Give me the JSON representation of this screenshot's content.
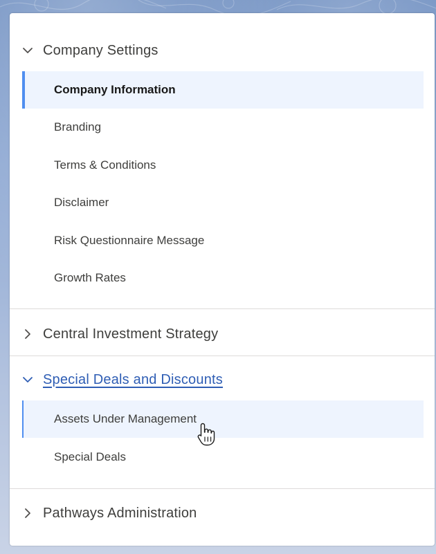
{
  "sections": [
    {
      "title": "Company Settings",
      "expanded": true,
      "items": [
        {
          "label": "Company Information",
          "state": "selected"
        },
        {
          "label": "Branding"
        },
        {
          "label": "Terms & Conditions"
        },
        {
          "label": "Disclaimer"
        },
        {
          "label": "Risk Questionnaire Message"
        },
        {
          "label": "Growth Rates"
        }
      ]
    },
    {
      "title": "Central Investment Strategy",
      "expanded": false,
      "items": []
    },
    {
      "title": "Special Deals and Discounts",
      "expanded": true,
      "items": [
        {
          "label": "Assets Under Management",
          "state": "hover"
        },
        {
          "label": "Special Deals"
        }
      ]
    },
    {
      "title": "Pathways Administration",
      "expanded": false,
      "items": []
    }
  ],
  "colors": {
    "accent": "#4f8ef0",
    "selected_bg": "#eef4fe",
    "link": "#2e5db4",
    "text": "#3e3e3c"
  },
  "icons": {
    "expanded": "chevron-down-icon",
    "collapsed": "chevron-right-icon",
    "cursor": "hand-pointer-icon"
  }
}
